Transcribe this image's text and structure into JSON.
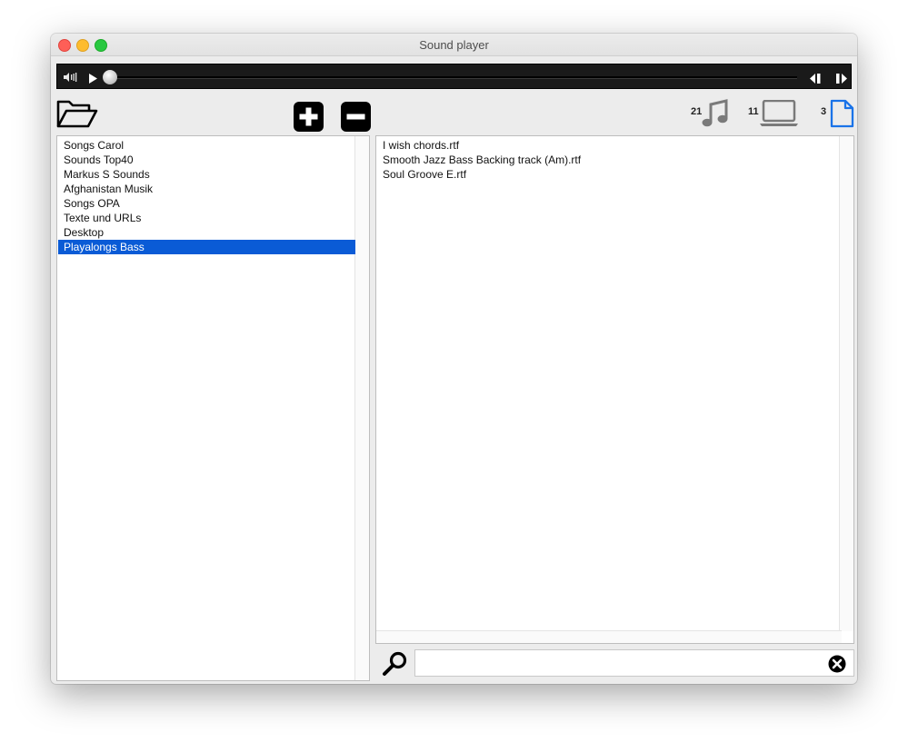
{
  "window": {
    "title": "Sound player"
  },
  "player": {
    "volume_icon": "volume-icon",
    "play_icon": "play-icon",
    "prev_icon": "previous-icon",
    "next_icon": "next-icon",
    "progress": 0
  },
  "toolbar": {
    "open_icon": "folder-open-icon",
    "add_icon": "plus-icon",
    "remove_icon": "minus-icon",
    "music_count": "21",
    "computer_count": "11",
    "document_count": "3",
    "accent_color": "#1a73e8"
  },
  "folders": {
    "items": [
      "Songs Carol",
      "Sounds Top40",
      "Markus S Sounds",
      "Afghanistan Musik",
      "Songs OPA",
      "Texte und URLs",
      "Desktop",
      "Playalongs Bass"
    ],
    "selected": "Playalongs Bass",
    "selection_color": "#0a5bd6"
  },
  "files": {
    "items": [
      "I wish chords.rtf",
      "Smooth Jazz Bass Backing track (Am).rtf",
      "Soul Groove E.rtf"
    ]
  },
  "search": {
    "value": "",
    "search_icon": "search-icon",
    "clear_icon": "clear-icon"
  }
}
